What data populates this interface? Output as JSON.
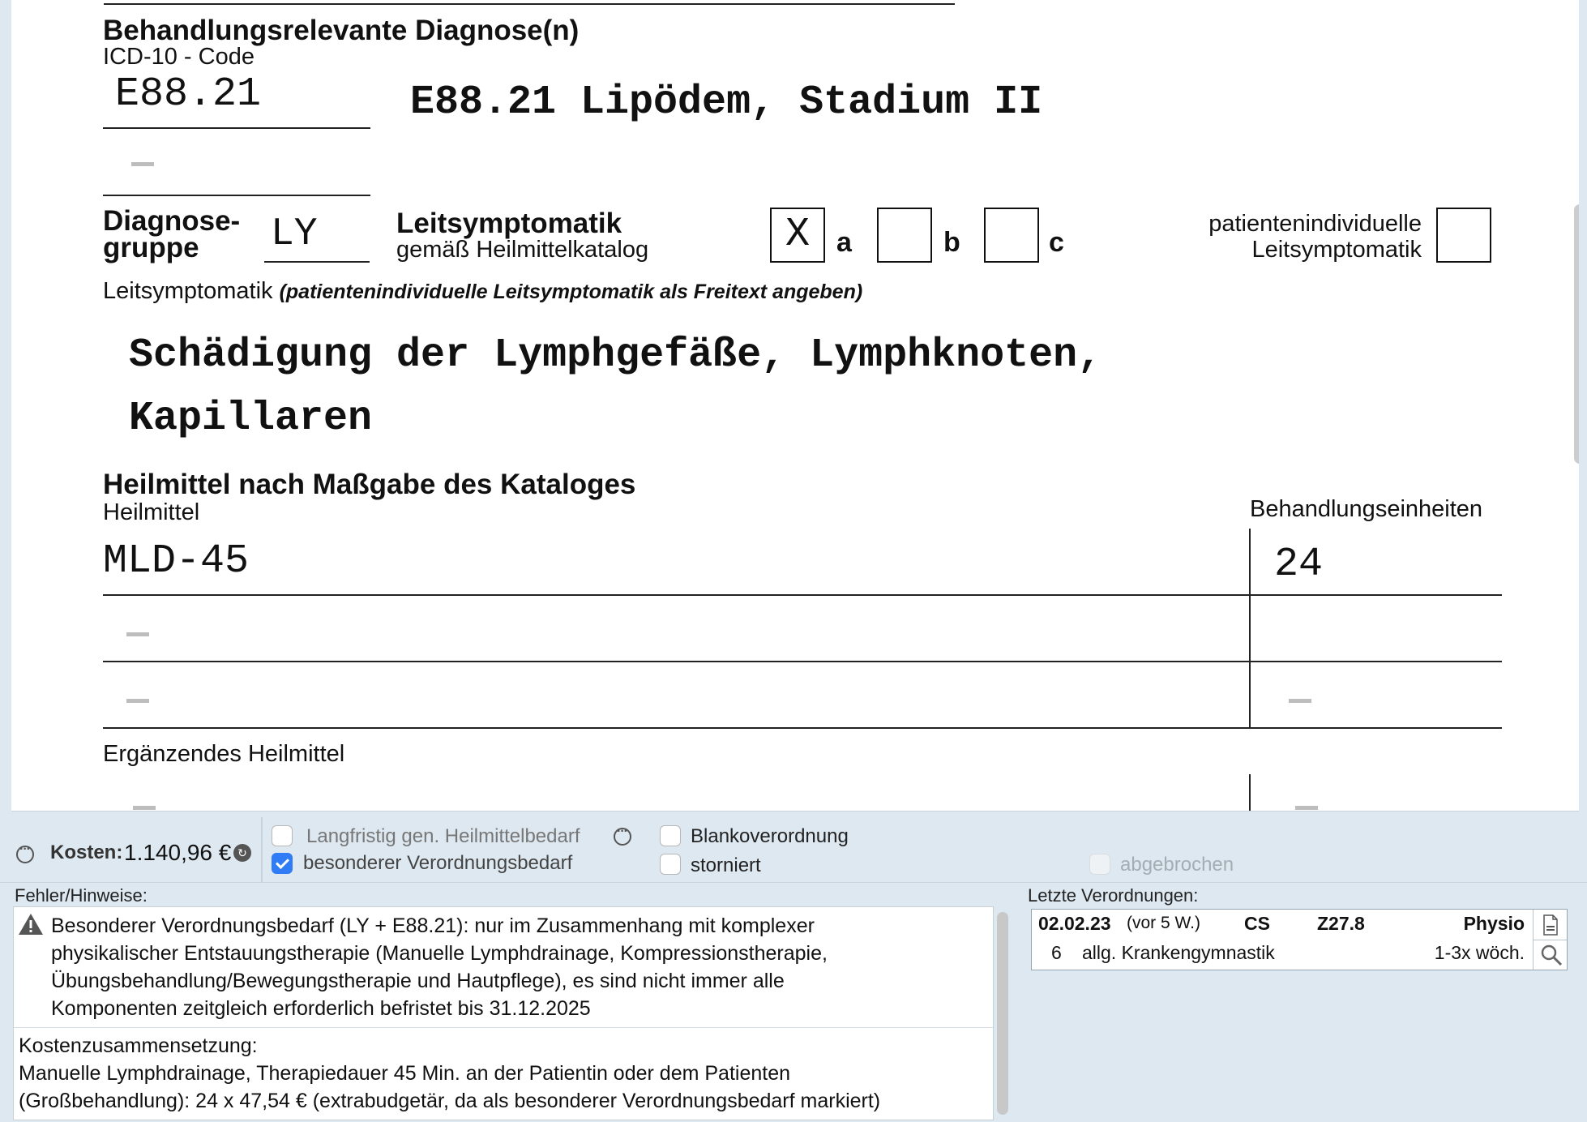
{
  "form": {
    "diagnoses_title": "Behandlungsrelevante Diagnose(n)",
    "icd_label": "ICD-10 - Code",
    "icd_code_1": "E88.21",
    "icd_text_1": "E88.21 Lipödem, Stadium II",
    "diag_group_label_line1": "Diagnose-",
    "diag_group_label_line2": "gruppe",
    "diag_group_value": "LY",
    "leitsymptomatik_title": "Leitsymptomatik",
    "leitsymptomatik_sub": "gemäß Heilmittelkatalog",
    "checkbox_a_value": "X",
    "letter_a": "a",
    "letter_b": "b",
    "letter_c": "c",
    "individual_label_line1": "patientenindividuelle",
    "individual_label_line2": "Leitsymptomatik",
    "leitsymptomatik_freetext_label": "Leitsymptomatik",
    "leitsymptomatik_freetext_hint": "(patientenindividuelle Leitsymptomatik als Freitext angeben)",
    "leitsymptomatik_text_line1": "Schädigung der Lymphgefäße, Lymphknoten,",
    "leitsymptomatik_text_line2": "Kapillaren",
    "heilmittel_title": "Heilmittel nach Maßgabe des Kataloges",
    "heilmittel_label": "Heilmittel",
    "units_label": "Behandlungseinheiten",
    "heilmittel_1": "MLD-45",
    "units_1": "24",
    "supplementary_label": "Ergänzendes Heilmittel"
  },
  "status": {
    "cost_label": "Kosten:",
    "cost_value": "1.140,96 €",
    "longterm_label": "Langfristig gen. Heilmittelbedarf",
    "longterm_checked": false,
    "special_label": "besonderer Verordnungsbedarf",
    "special_checked": true,
    "blank_label": "Blankoverordnung",
    "blank_checked": false,
    "cancelled_label": "storniert",
    "cancelled_checked": false,
    "aborted_label": "abgebrochen",
    "aborted_checked": false
  },
  "hints": {
    "title": "Fehler/Hinweise:",
    "warning_line1": "Besonderer Verordnungsbedarf (LY + E88.21): nur im Zusammenhang mit komplexer",
    "warning_line2": "physikalischer Entstauungstherapie (Manuelle Lymphdrainage, Kompressionstherapie,",
    "warning_line3": "Übungsbehandlung/Bewegungstherapie und Hautpflege), es sind nicht immer alle",
    "warning_line4": "Komponenten zeitgleich erforderlich befristet bis 31.12.2025",
    "cost_title": "Kostenzusammensetzung:",
    "cost_line1": "Manuelle Lymphdrainage, Therapiedauer 45 Min. an der Patientin oder dem Patienten",
    "cost_line2": "(Großbehandlung): 24 x 47,54 € (extrabudgetär, da als besonderer Verordnungsbedarf markiert)"
  },
  "history": {
    "title": "Letzte Verordnungen:",
    "entry": {
      "date": "02.02.23",
      "ago": "(vor 5 W.)",
      "initials": "CS",
      "code": "Z27.8",
      "type": "Physio",
      "count": "6",
      "therapy": "allg. Krankengymnastik",
      "frequency": "1-3x wöch."
    }
  },
  "icons": {
    "warning": "warning-triangle-icon",
    "document": "document-icon",
    "search": "magnifier-icon",
    "info": "ellipsis-circle-icon"
  }
}
